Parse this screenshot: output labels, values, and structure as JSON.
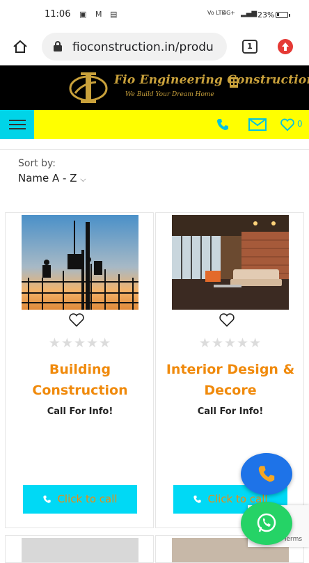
{
  "status_bar": {
    "time": "11:06",
    "network": "Vo LTE",
    "signal": "4G+",
    "battery": "23%",
    "battery_level": 0.23
  },
  "browser": {
    "url": "fioconstruction.in/produ",
    "tab_count": "1"
  },
  "site": {
    "name": "Fio Engineering Construction",
    "tagline": "We Build Your Dream Home",
    "wishlist_count": "0",
    "colors": {
      "header_bg": "#000000",
      "bar_bg": "#ffff00",
      "accent_cyan": "#00d4e8",
      "title_orange": "#f08a0c",
      "gold": "#c9a13b"
    }
  },
  "sort": {
    "label": "Sort by:",
    "value": "Name A - Z"
  },
  "products": [
    {
      "title": "Building Construction",
      "info": "Call For Info!",
      "cta": "Click to call",
      "rating": 0
    },
    {
      "title": "Interior Design & Decore",
      "info": "Call For Info!",
      "cta": "Click to call",
      "rating": 0
    }
  ],
  "recaptcha": {
    "text": "Privacy - Terms"
  },
  "icons": [
    "home-icon",
    "lock-icon",
    "tabs-icon",
    "update-icon",
    "menu-icon",
    "phone-icon",
    "mail-icon",
    "heart-icon",
    "star-icon",
    "whatsapp-icon",
    "chevron-down-icon"
  ]
}
